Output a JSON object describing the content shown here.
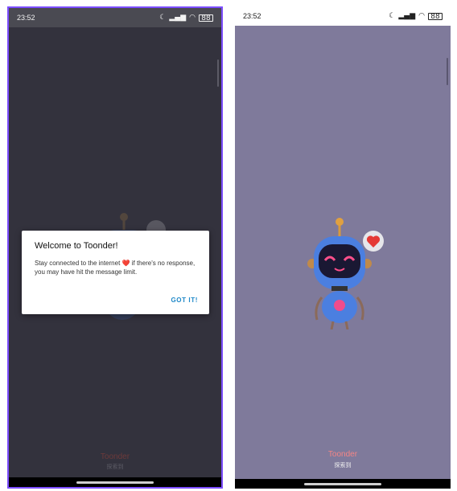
{
  "left_screen": {
    "status_time": "23:52",
    "battery": "88",
    "app_name": "Toonder",
    "app_subtitle": "探索到",
    "dialog": {
      "title": "Welcome to Toonder!",
      "body_before_heart": "Stay connected to the internet",
      "heart": "❤️",
      "body_after_heart": "if there's no response, you may have hit the message limit.",
      "button": "GOT IT!"
    }
  },
  "right_screen": {
    "status_time": "23:52",
    "battery": "88",
    "app_name": "Toonder",
    "app_subtitle": "探索到"
  },
  "colors": {
    "accent_frame": "#7c4dff",
    "dialog_button": "#1e88c8",
    "app_name": "#f48585",
    "right_background": "#7f7a9b",
    "left_background": "#33323d"
  },
  "icons": [
    "moon-icon",
    "signal-icon",
    "wifi-icon",
    "battery-icon",
    "robot-mascot",
    "heart-bubble-icon"
  ]
}
